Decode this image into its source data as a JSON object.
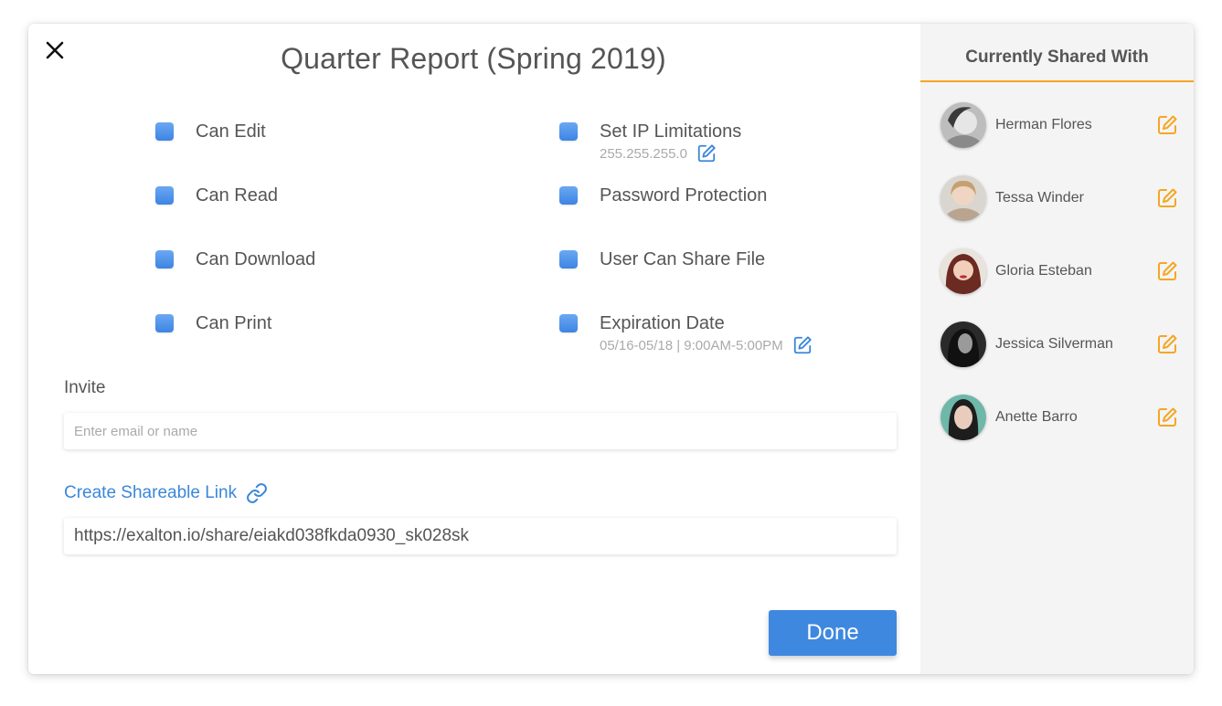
{
  "dialog": {
    "title": "Quarter Report (Spring 2019)",
    "close_icon": "close-icon"
  },
  "permissions": {
    "left": [
      {
        "label": "Can Edit",
        "checked": true
      },
      {
        "label": "Can Read",
        "checked": true
      },
      {
        "label": "Can Download",
        "checked": true
      },
      {
        "label": "Can Print",
        "checked": true
      }
    ],
    "right": [
      {
        "label": "Set IP Limitations",
        "sub": "255.255.255.0",
        "checked": true
      },
      {
        "label": "Password Protection",
        "checked": true
      },
      {
        "label": "User Can Share File",
        "checked": true
      },
      {
        "label": "Expiration Date",
        "sub": "05/16-05/18 | 9:00AM-5:00PM",
        "checked": true
      }
    ]
  },
  "invite": {
    "label": "Invite",
    "placeholder": "Enter email or name"
  },
  "share_link": {
    "label": "Create Shareable Link",
    "icon": "link-icon",
    "url": "https://exalton.io/share/eiakd038fkda0930_sk028sk"
  },
  "done_label": "Done",
  "sidebar": {
    "title": "Currently Shared With",
    "users": [
      {
        "name": "Herman Flores"
      },
      {
        "name": "Tessa Winder"
      },
      {
        "name": "Gloria Esteban"
      },
      {
        "name": "Jessica Silverman"
      },
      {
        "name": "Anette Barro"
      }
    ]
  },
  "colors": {
    "accent_blue": "#3f88e0",
    "link_blue": "#3a87d9",
    "checkbox_blue": "#4a8fe8",
    "accent_orange": "#f5a623",
    "sidebar_bg": "#f4f4f4",
    "text": "#555555"
  }
}
